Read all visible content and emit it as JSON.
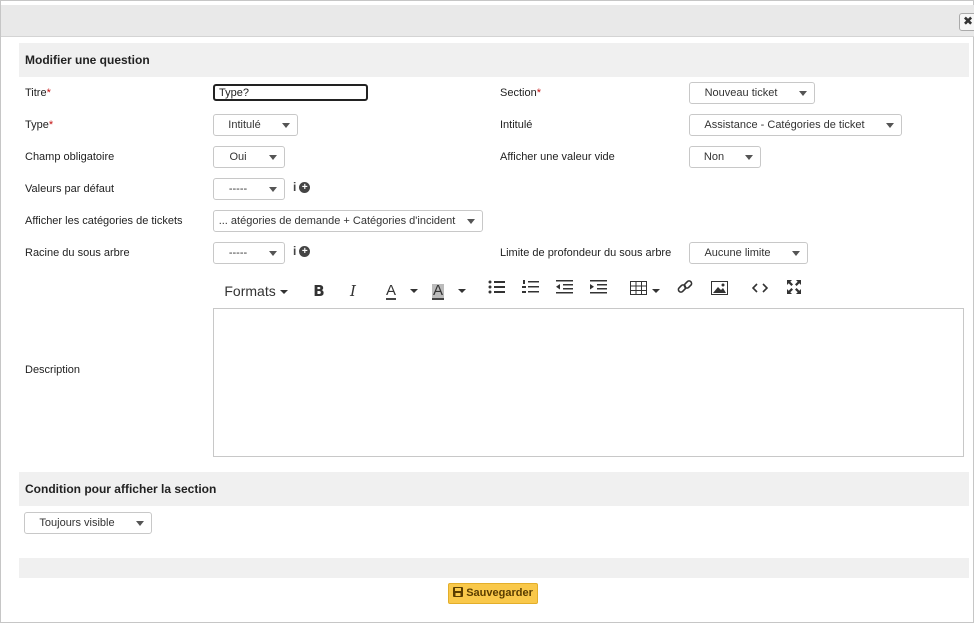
{
  "window": {
    "close_glyph": "✖",
    "close_icon": "close-icon"
  },
  "form": {
    "section_title": "Modifier une question",
    "titre_label": "Titre",
    "required_mark": "*",
    "titre_value": "Type?",
    "type_label": "Type",
    "type_value": "Intitulé",
    "champ_obligatoire_label": "Champ obligatoire",
    "champ_obligatoire_value": "Oui",
    "valeurs_defaut_label": "Valeurs par défaut",
    "valeurs_defaut_value": "-----",
    "afficher_categories_label": "Afficher les catégories de tickets",
    "afficher_categories_value": "... atégories de demande + Catégories d'incident",
    "racine_label": "Racine du sous arbre",
    "racine_value": "-----",
    "section_label": "Section",
    "section_value": "Nouveau ticket",
    "intitule_label": "Intitulé",
    "intitule_value": "Assistance - Catégories de ticket",
    "afficher_vide_label": "Afficher une valeur vide",
    "afficher_vide_value": "Non",
    "limite_label": "Limite de profondeur du sous arbre",
    "limite_value": "Aucune limite",
    "description_label": "Description",
    "info_glyph": "i"
  },
  "toolbar": {
    "formats_label": "Formats",
    "bold_glyph": "B",
    "italic_glyph": "I",
    "text_color_glyph": "A",
    "bg_color_glyph": "A",
    "icons": [
      "bold-icon",
      "italic-icon",
      "text-color-icon",
      "background-color-icon",
      "bullet-list-icon",
      "numbered-list-icon",
      "outdent-icon",
      "indent-icon",
      "table-icon",
      "link-icon",
      "image-icon",
      "code-icon",
      "fullscreen-icon"
    ]
  },
  "condition": {
    "title": "Condition pour afficher la section",
    "value": "Toujours visible"
  },
  "footer": {
    "save_label": "Sauvegarder"
  },
  "colors": {
    "required": "#c41010",
    "save_button": "#f9c84a",
    "header_bg": "#f0f0f0"
  }
}
